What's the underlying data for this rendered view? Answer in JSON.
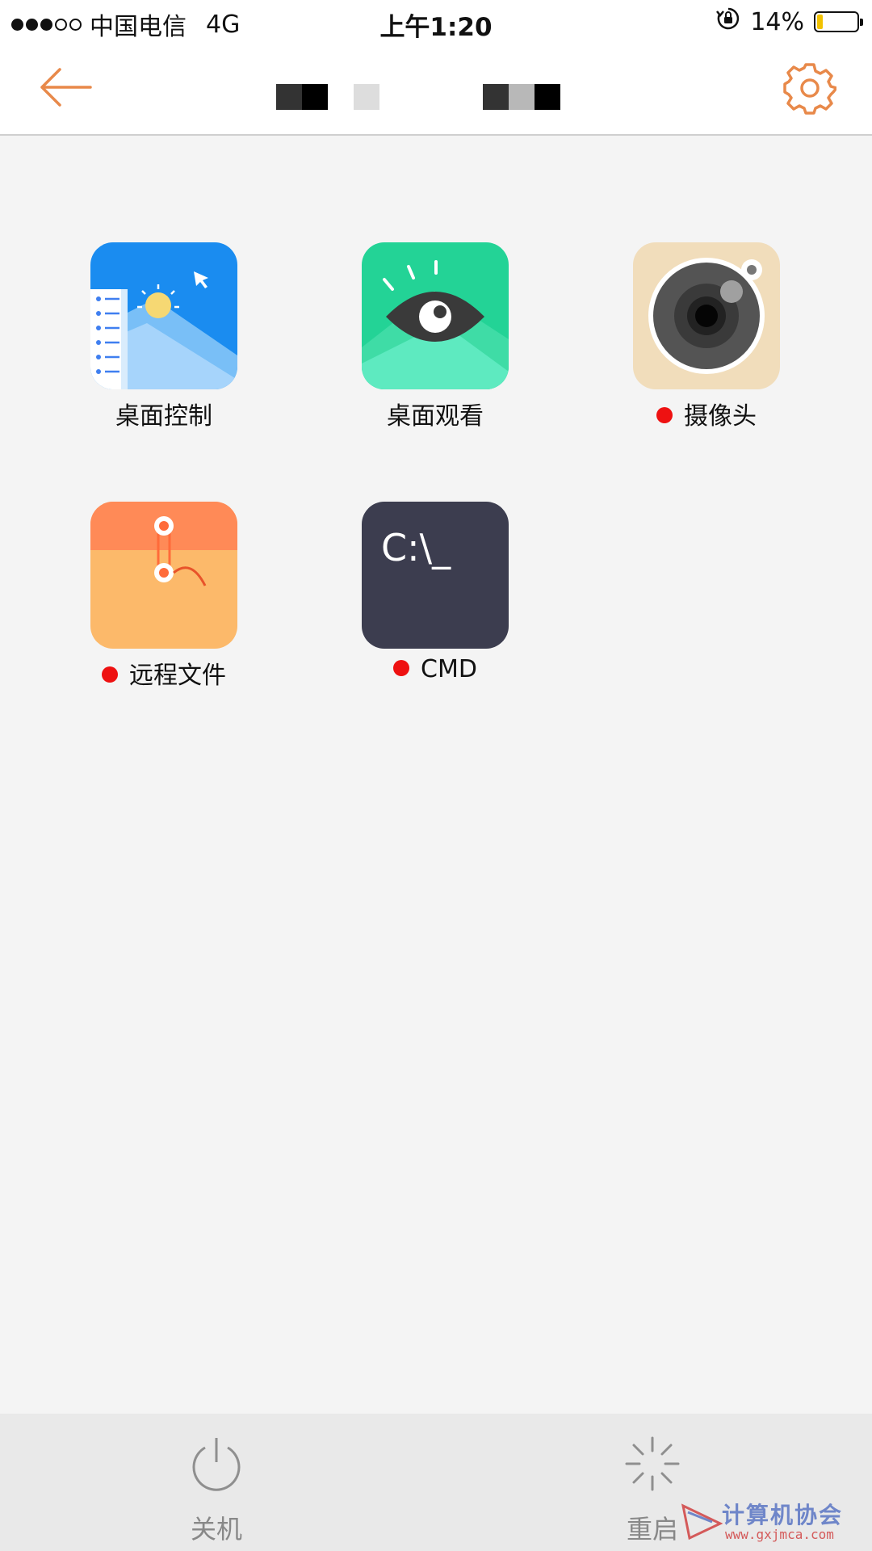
{
  "status_bar": {
    "carrier": "中国电信",
    "network": "4G",
    "time": "上午1:20",
    "battery_percent": "14%",
    "battery_level": 0.14,
    "signal_strength": "3 of 5"
  },
  "nav": {
    "back_icon": "arrow-left-icon",
    "settings_icon": "gear-icon",
    "accent_color": "#e8894a"
  },
  "apps": [
    {
      "label": "桌面控制",
      "icon": "desktop-control-icon",
      "status_dot": false
    },
    {
      "label": "桌面观看",
      "icon": "eye-icon",
      "status_dot": false
    },
    {
      "label": "摄像头",
      "icon": "camera-icon",
      "status_dot": true
    },
    {
      "label": "远程文件",
      "icon": "file-folder-icon",
      "status_dot": true
    },
    {
      "label": "CMD",
      "icon": "terminal-icon",
      "status_dot": true,
      "icon_text": "C:\\_"
    }
  ],
  "toolbar": {
    "shutdown_label": "关机",
    "restart_label": "重启"
  },
  "watermark": {
    "text": "计算机协会",
    "url": "www.gxjmca.com"
  }
}
